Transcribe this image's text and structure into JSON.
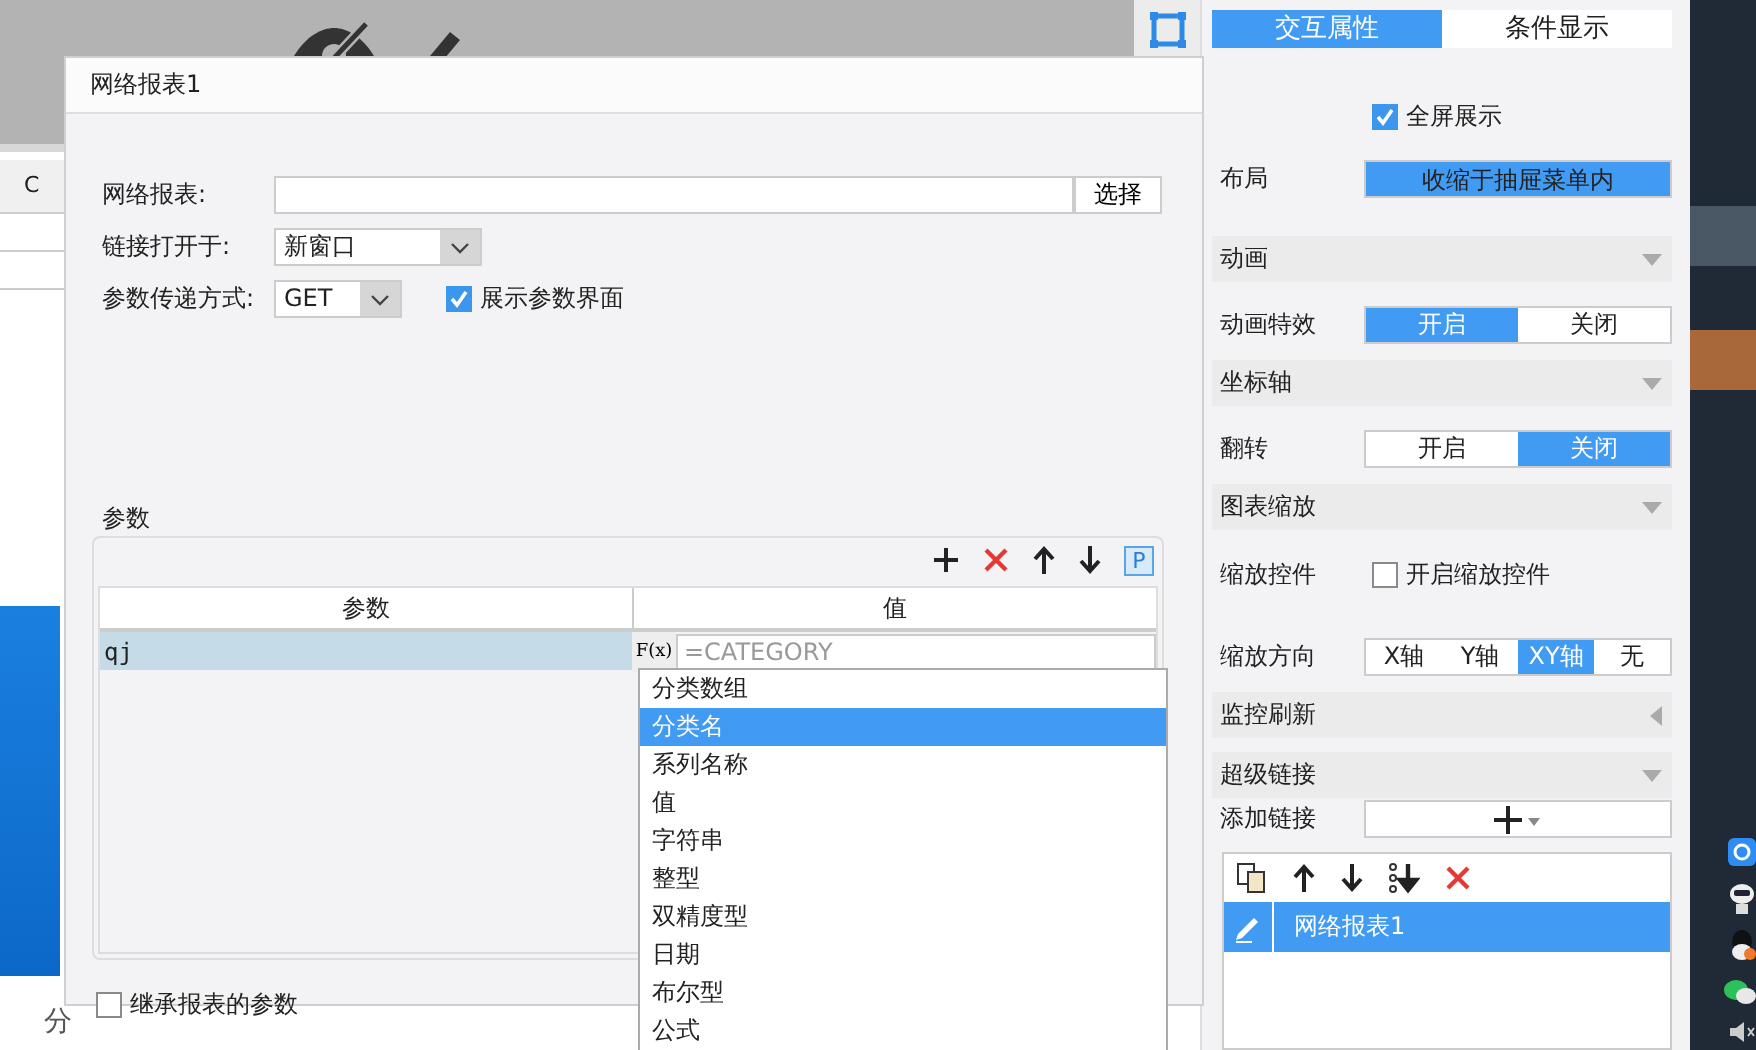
{
  "background": {
    "column_header": "C",
    "axis_label": "分"
  },
  "dialog": {
    "title": "网络报表1",
    "report": {
      "label": "网络报表:",
      "button": "选择"
    },
    "open_in": {
      "label": "链接打开于:",
      "value": "新窗口"
    },
    "method": {
      "label": "参数传递方式:",
      "value": "GET"
    },
    "show_params": {
      "label": "展示参数界面",
      "checked": true
    },
    "params": {
      "legend": "参数",
      "toolbar": [
        {
          "kind": "add"
        },
        {
          "kind": "delete"
        },
        {
          "kind": "up"
        },
        {
          "kind": "down"
        },
        {
          "kind": "param",
          "label": "P"
        }
      ],
      "columns": [
        "参数",
        "值"
      ],
      "rows": [
        {
          "name": "qj",
          "formula_button": "F(x)",
          "placeholder": "=CATEGORY"
        }
      ],
      "menu": [
        {
          "label": "分类数组",
          "selected": false
        },
        {
          "label": "分类名",
          "selected": true
        },
        {
          "label": "系列名称",
          "selected": false
        },
        {
          "label": "值",
          "selected": false
        },
        {
          "label": "字符串",
          "selected": false
        },
        {
          "label": "整型",
          "selected": false
        },
        {
          "label": "双精度型",
          "selected": false
        },
        {
          "label": "日期",
          "selected": false
        },
        {
          "label": "布尔型",
          "selected": false
        },
        {
          "label": "公式",
          "selected": false
        }
      ]
    },
    "inherit": {
      "label": "继承报表的参数",
      "checked": false
    }
  },
  "panel": {
    "tabs": [
      {
        "label": "交互属性",
        "selected": true
      },
      {
        "label": "条件显示",
        "selected": false
      }
    ],
    "rows": [
      {
        "kind": "check",
        "text": "全屏展示",
        "checked": true
      },
      {
        "kind": "option",
        "label": "布局",
        "value": "收缩于抽屉菜单内"
      },
      {
        "kind": "section",
        "title": "动画",
        "expanded": true
      },
      {
        "kind": "segmented",
        "label": "动画特效",
        "options": [
          {
            "label": "开启",
            "selected": true
          },
          {
            "label": "关闭",
            "selected": false
          }
        ]
      },
      {
        "kind": "section",
        "title": "坐标轴",
        "expanded": true
      },
      {
        "kind": "segmented",
        "label": "翻转",
        "options": [
          {
            "label": "开启",
            "selected": false
          },
          {
            "label": "关闭",
            "selected": true
          }
        ]
      },
      {
        "kind": "section",
        "title": "图表缩放",
        "expanded": true
      },
      {
        "kind": "checkbox",
        "label": "缩放控件",
        "text": "开启缩放控件",
        "checked": false
      },
      {
        "kind": "segmented",
        "label": "缩放方向",
        "options": [
          {
            "label": "X轴",
            "selected": false
          },
          {
            "label": "Y轴",
            "selected": false
          },
          {
            "label": "XY轴",
            "selected": true
          },
          {
            "label": "无",
            "selected": false
          }
        ]
      },
      {
        "kind": "section",
        "title": "监控刷新",
        "expanded": false
      },
      {
        "kind": "section",
        "title": "超级链接",
        "expanded": true
      },
      {
        "kind": "add",
        "label": "添加链接"
      }
    ],
    "links": {
      "toolbar": [
        {
          "kind": "copy"
        },
        {
          "kind": "up"
        },
        {
          "kind": "down"
        },
        {
          "kind": "sort"
        },
        {
          "kind": "delete"
        }
      ],
      "items": [
        {
          "label": "网络报表1",
          "selected": true
        }
      ]
    }
  }
}
